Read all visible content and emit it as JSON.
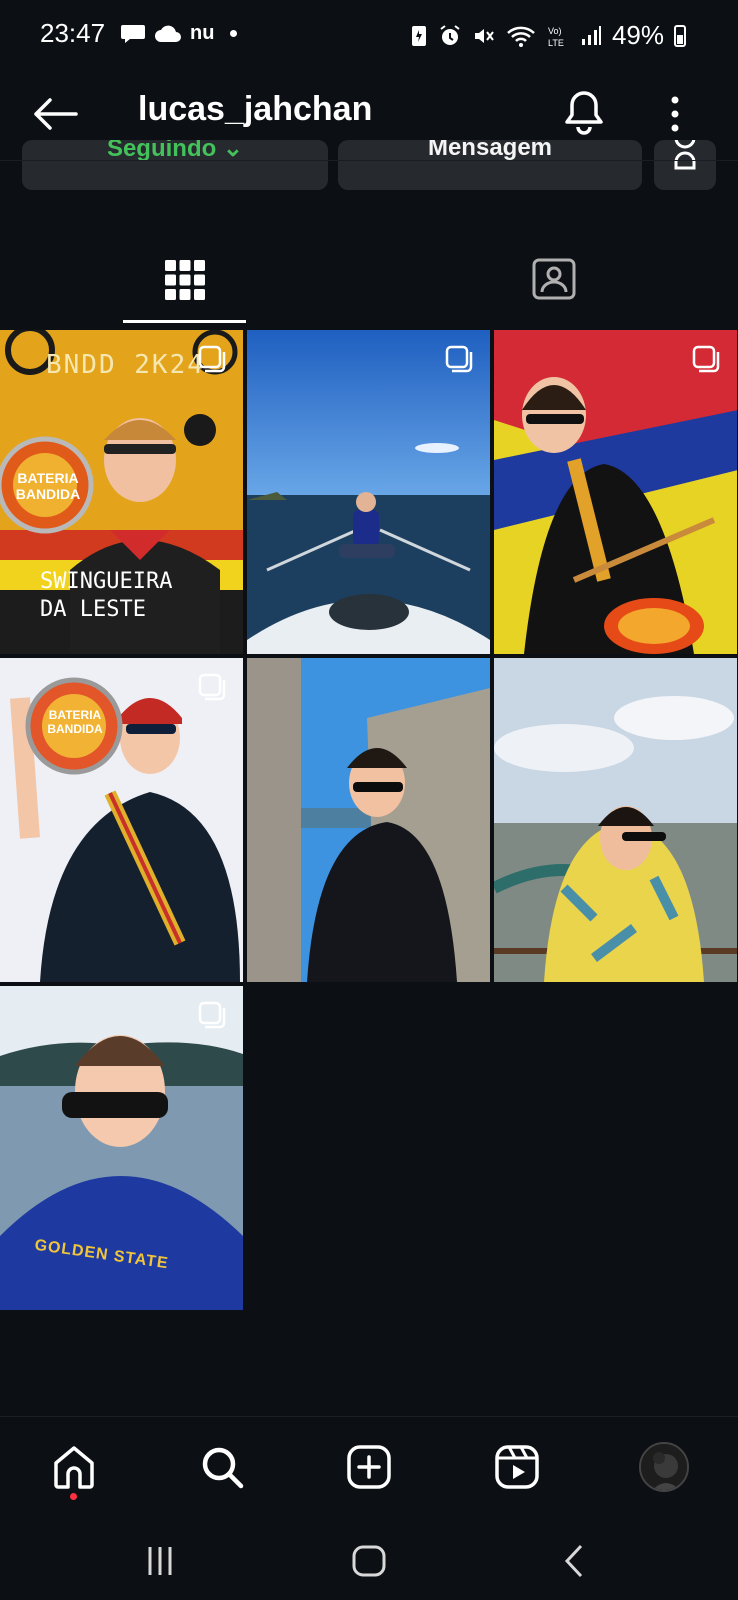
{
  "status_bar": {
    "time": "23:47",
    "carrier_text": "nu",
    "battery": "49%",
    "lte_label": "VoLTE"
  },
  "header": {
    "username": "lucas_jahchan"
  },
  "actions": {
    "follow_label": "Seguindo",
    "message_label": "Mensagem"
  },
  "tabs": [
    {
      "name": "posts-grid",
      "icon": "grid-icon",
      "active": true
    },
    {
      "name": "tagged",
      "icon": "tagged-person-icon",
      "active": false
    }
  ],
  "posts": [
    {
      "description": "Bateria Bandida poster",
      "poster_text_1": "BNDD 2K24",
      "poster_text_2": "SWINGUEIRA DA LESTE",
      "drum_text": "BATERIA BANDIDA",
      "multi": true
    },
    {
      "description": "Man seated on boat bow at sea",
      "multi": true
    },
    {
      "description": "Drummer playing in front of yellow flag",
      "multi": true
    },
    {
      "description": "Man holding drum against white background",
      "drum_text": "BATERIA BANDIDA",
      "multi": true
    },
    {
      "description": "Man with sunglasses next to stone ruins",
      "multi": false
    },
    {
      "description": "Man in floral shirt above Paris",
      "multi": false
    },
    {
      "description": "Man in blue shirt by the water",
      "shirt_text": "GOLDEN STATE",
      "multi": true
    }
  ],
  "colors": {
    "background": "#0c1014",
    "follow_green": "#43c15a",
    "button_bg": "#26292d",
    "notification_dot": "#ff3040"
  },
  "bottom_nav": [
    {
      "name": "home",
      "icon": "home-icon"
    },
    {
      "name": "search",
      "icon": "search-icon"
    },
    {
      "name": "create",
      "icon": "plus-square-icon"
    },
    {
      "name": "reels",
      "icon": "reels-icon"
    },
    {
      "name": "profile",
      "icon": "avatar"
    }
  ],
  "system_nav": [
    {
      "name": "recents",
      "icon": "recents-icon"
    },
    {
      "name": "home",
      "icon": "home-circle-icon"
    },
    {
      "name": "back",
      "icon": "back-chevron-icon"
    }
  ]
}
